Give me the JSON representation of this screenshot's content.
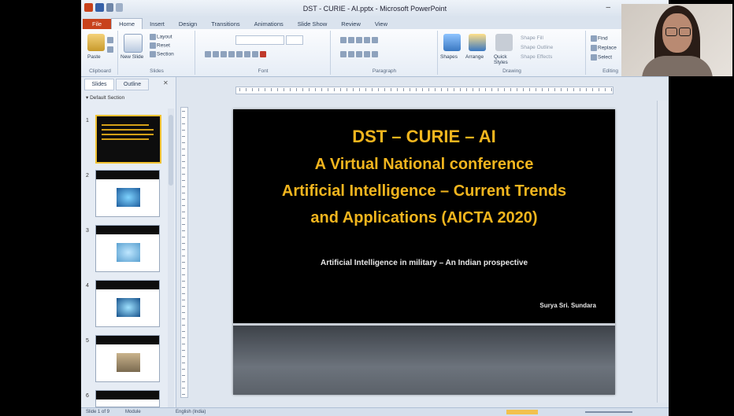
{
  "window": {
    "title": "DST - CURIE - AI.pptx - Microsoft PowerPoint",
    "minimize": "–"
  },
  "ribbon": {
    "tabs": [
      "File",
      "Home",
      "Insert",
      "Design",
      "Transitions",
      "Animations",
      "Slide Show",
      "Review",
      "View"
    ],
    "groups": [
      "Clipboard",
      "Slides",
      "Font",
      "Paragraph",
      "Drawing",
      "Editing"
    ],
    "buttons": {
      "paste": "Paste",
      "new_slide": "New Slide",
      "layout": "Layout",
      "reset": "Reset",
      "section": "Section",
      "shapes": "Shapes",
      "arrange": "Arrange",
      "quick_styles": "Quick Styles",
      "shape_fill": "Shape Fill",
      "shape_outline": "Shape Outline",
      "shape_effects": "Shape Effects",
      "find": "Find",
      "replace": "Replace",
      "select": "Select"
    }
  },
  "left_pane": {
    "tabs": [
      "Slides",
      "Outline"
    ],
    "section_label": "Default Section",
    "slide_numbers": [
      "1",
      "2",
      "3",
      "4",
      "5",
      "6"
    ]
  },
  "slide": {
    "title_lines": [
      "DST – CURIE – AI",
      "A Virtual National conference",
      "Artificial Intelligence – Current Trends",
      "and Applications (AICTA 2020)"
    ],
    "subtitle": "Artificial Intelligence in military – An Indian prospective",
    "author": "Surya Sri. Sundara"
  },
  "status_bar": {
    "slide_info": "Slide 1 of 9",
    "theme": "Module",
    "language": "English (India)"
  }
}
